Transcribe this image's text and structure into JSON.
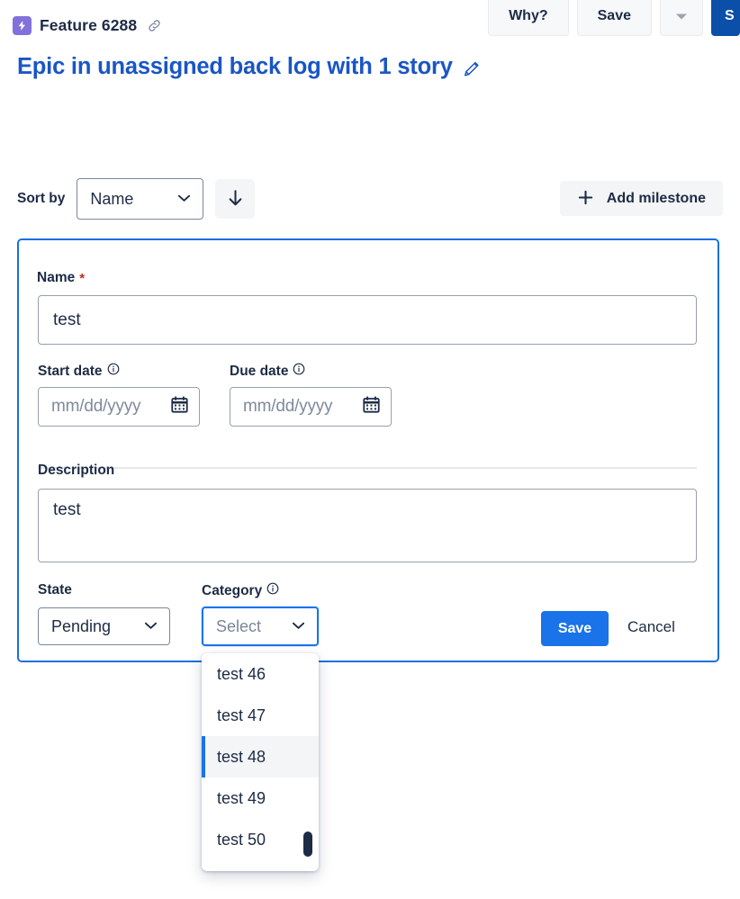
{
  "topbar": {
    "feature_icon": "bolt-icon",
    "breadcrumb_label": "Feature 6288",
    "link_icon": "link-icon",
    "why_label": "Why?",
    "save_label": "Save",
    "caret_icon": "chevron-down-icon",
    "primary_label": "S"
  },
  "epic": {
    "title": "Epic in unassigned back log with 1 story",
    "edit_icon": "pencil-icon"
  },
  "sort": {
    "label": "Sort by",
    "value": "Name",
    "chevron_icon": "chevron-down-icon",
    "direction_icon": "arrow-down-icon",
    "add_milestone_label": "Add milestone",
    "add_icon": "plus-icon"
  },
  "card": {
    "name": {
      "label": "Name",
      "required_mark": "*",
      "value": "test"
    },
    "start_date": {
      "label": "Start date",
      "info_icon": "info-icon",
      "placeholder": "mm/dd/yyyy",
      "value": "mm/dd/yyyy",
      "calendar_icon": "calendar-icon"
    },
    "due_date": {
      "label": "Due date",
      "info_icon": "info-icon",
      "placeholder": "mm/dd/yyyy",
      "value": "mm/dd/yyyy",
      "calendar_icon": "calendar-icon"
    },
    "description": {
      "label": "Description",
      "value": "test"
    },
    "state": {
      "label": "State",
      "value": "Pending",
      "chevron_icon": "chevron-down-icon"
    },
    "category": {
      "label": "Category",
      "info_icon": "info-icon",
      "value": "Select",
      "chevron_icon": "chevron-down-icon"
    },
    "save_label": "Save",
    "cancel_label": "Cancel"
  },
  "dropdown": {
    "options": [
      {
        "label": "test 46",
        "active": false
      },
      {
        "label": "test 47",
        "active": false
      },
      {
        "label": "test 48",
        "active": true
      },
      {
        "label": "test 49",
        "active": false
      },
      {
        "label": "test 50",
        "active": false
      }
    ]
  },
  "colors": {
    "accent_blue": "#1a73e8",
    "title_blue": "#1a56c4",
    "primary_dark_blue": "#0b4fa8",
    "feature_purple": "#8270db",
    "text_dark": "#1d2b45",
    "required_red": "#b32d1f",
    "muted_grey": "#7f8a9b",
    "panel_grey": "#f4f5f7"
  }
}
